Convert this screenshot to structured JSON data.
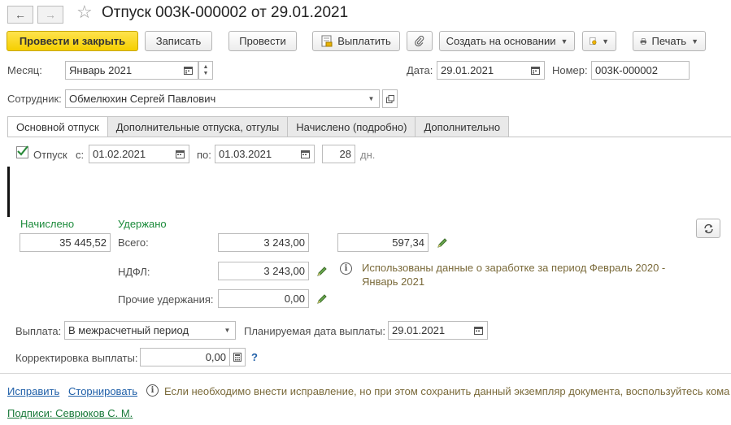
{
  "window": {
    "title": "Отпуск 003К-000002 от 29.01.2021"
  },
  "toolbar": {
    "post_close": "Провести и закрыть",
    "write": "Записать",
    "post": "Провести",
    "pay": "Выплатить",
    "create_based": "Создать на основании",
    "print": "Печать"
  },
  "header": {
    "month_label": "Месяц:",
    "month_value": "Январь 2021",
    "date_label": "Дата:",
    "date_value": "29.01.2021",
    "number_label": "Номер:",
    "number_value": "003К-000002",
    "employee_label": "Сотрудник:",
    "employee_value": "Обмелюхин Сергей Павлович"
  },
  "tabs": [
    {
      "label": "Основной отпуск",
      "active": true
    },
    {
      "label": "Дополнительные отпуска, отгулы",
      "active": false
    },
    {
      "label": "Начислено (подробно)",
      "active": false
    },
    {
      "label": "Дополнительно",
      "active": false
    }
  ],
  "vacation": {
    "checkbox_label": "Отпуск",
    "checked": true,
    "from_label": "с:",
    "from_value": "01.02.2021",
    "to_label": "по:",
    "to_value": "01.03.2021",
    "days_value": "28",
    "days_unit": "дн."
  },
  "accrued": {
    "accrued_label": "Начислено",
    "accrued_value": "35 445,52",
    "withheld_label": "Удержано",
    "total_label": "Всего:",
    "total_value": "3 243,00",
    "extra_value": "597,34",
    "ndfl_label": "НДФЛ:",
    "ndfl_value": "3 243,00",
    "other_label": "Прочие удержания:",
    "other_value": "0,00",
    "info_text_1": "Использованы данные о заработке за период Февраль 2020 -",
    "info_text_2": "Январь 2021"
  },
  "payment": {
    "label": "Выплата:",
    "value": "В межрасчетный период",
    "planned_label": "Планируемая дата выплаты:",
    "planned_value": "29.01.2021",
    "correction_label": "Корректировка выплаты:",
    "correction_value": "0,00",
    "help": "?"
  },
  "footer": {
    "fix_link": "Исправить",
    "reverse_link": "Сторнировать",
    "note": "Если необходимо внести исправление, но при этом сохранить данный экземпляр документа, воспользуйтесь кома",
    "signatures_link": "Подписи: Севрюков С. М."
  },
  "colors": {
    "accent_yellow": "#f5cf00",
    "green_label": "#1a8a3a",
    "link_blue": "#1f5fa8"
  }
}
